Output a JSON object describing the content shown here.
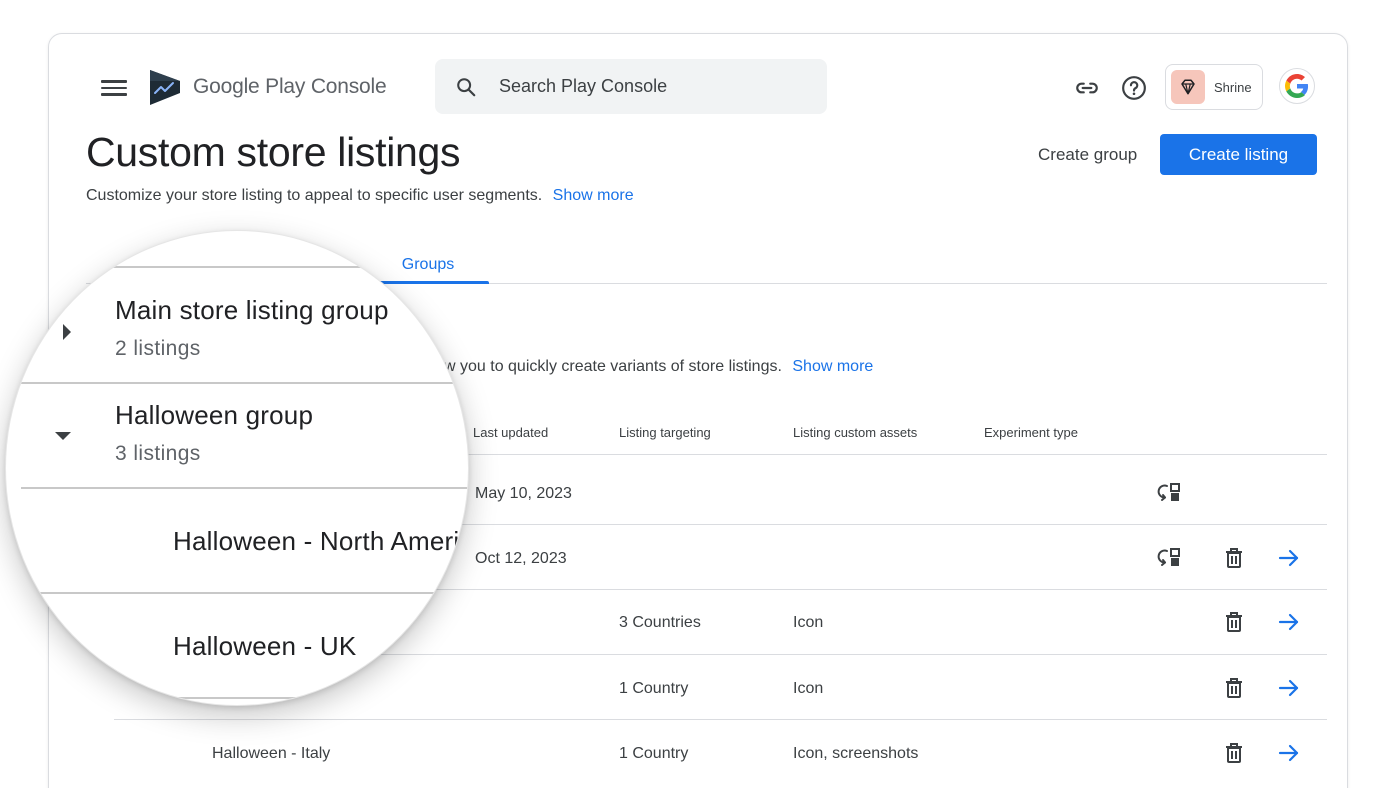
{
  "header": {
    "app_name": "Google Play Console",
    "search_placeholder": "Search Play Console",
    "profile_name": "Shrine"
  },
  "page": {
    "title": "Custom store listings",
    "subtitle": "Customize your store listing to appeal to specific user segments.",
    "show_more": "Show more",
    "create_group": "Create group",
    "create_listing": "Create listing"
  },
  "tabs": {
    "groups": "Groups"
  },
  "groups_section": {
    "description": "w you to quickly create variants of store listings.",
    "show_more": "Show more"
  },
  "table": {
    "columns": {
      "last_updated": "Last updated",
      "listing_targeting": "Listing targeting",
      "listing_custom_assets": "Listing custom assets",
      "experiment_type": "Experiment type"
    },
    "rows": [
      {
        "name": "",
        "last_updated": "May 10, 2023",
        "targeting": "",
        "assets": ""
      },
      {
        "name": "",
        "last_updated": "Oct 12, 2023",
        "targeting": "",
        "assets": ""
      },
      {
        "name": "",
        "last_updated": "",
        "targeting": "3 Countries",
        "assets": "Icon"
      },
      {
        "name": "",
        "last_updated": "",
        "targeting": "1 Country",
        "assets": "Icon"
      },
      {
        "name": "Halloween - Italy",
        "last_updated": "",
        "targeting": "1 Country",
        "assets": "Icon, screenshots"
      }
    ]
  },
  "magnifier": {
    "group1_title": "Main store listing group",
    "group1_count": "2 listings",
    "group2_title": "Halloween group",
    "group2_count": "3 listings",
    "item1": "Halloween - North Americ",
    "item2": "Halloween - UK"
  },
  "colors": {
    "accent": "#1a73e8",
    "divider": "#dadce0",
    "text": "#202124",
    "muted": "#3c4043"
  }
}
